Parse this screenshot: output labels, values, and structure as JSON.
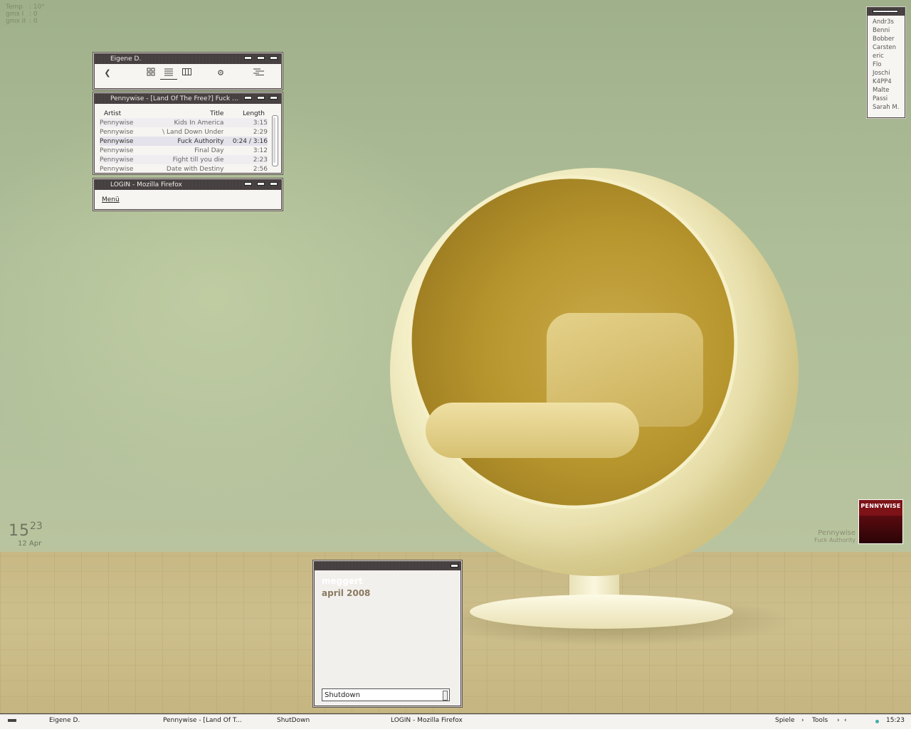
{
  "sysinfo": [
    {
      "label": "Temp",
      "value": ": 10°"
    },
    {
      "label": "gmx I",
      "value": ": 0"
    },
    {
      "label": "gmx II",
      "value": ": 0"
    }
  ],
  "explorer": {
    "title": "Eigene D.",
    "icons": [
      "back-icon",
      "icons-view-icon",
      "list-view-icon",
      "columns-view-icon",
      "settings-icon",
      "details-icon"
    ]
  },
  "player": {
    "title": "Pennywise - [Land Of The Free?] Fuck ...",
    "columns": {
      "artist": "Artist",
      "title": "Title",
      "length": "Length"
    },
    "rows": [
      {
        "artist": "Pennywise",
        "title": "Kids In America",
        "length": "3:15"
      },
      {
        "artist": "Pennywise",
        "title": "\\ Land Down Under",
        "length": "2:29"
      },
      {
        "artist": "Pennywise",
        "title": "Fuck Authority",
        "length": "0:24 / 3:16"
      },
      {
        "artist": "Pennywise",
        "title": "Final Day",
        "length": "3:12"
      },
      {
        "artist": "Pennywise",
        "title": "Fight till you die",
        "length": "2:23"
      },
      {
        "artist": "Pennywise",
        "title": "Date with Destiny",
        "length": "2:56"
      }
    ]
  },
  "firefox": {
    "title": "LOGIN - Mozilla Firefox",
    "menu_label": "Menü"
  },
  "buddies": [
    "Andr3s",
    "Benni",
    "Bobber",
    "Carsten",
    "eric",
    "Flo",
    "Joschi",
    "K4PP4",
    "Malte",
    "Passi",
    "Sarah M."
  ],
  "clock": {
    "hour": "15",
    "minute": "23",
    "date": "12 Apr"
  },
  "nowplaying": {
    "artist": "Pennywise",
    "track": "Fuck Authority",
    "cover_text": "PENNYWISE"
  },
  "shutdown": {
    "user": "meggert",
    "date": "april 2008",
    "selected": "Shutdown"
  },
  "taskbar": {
    "items": [
      "Eigene D.",
      "Pennywise - [Land Of T...",
      "ShutDown",
      "LOGIN - Mozilla Firefox"
    ],
    "menus": [
      "Spiele",
      "Tools"
    ],
    "time": "15:23"
  }
}
